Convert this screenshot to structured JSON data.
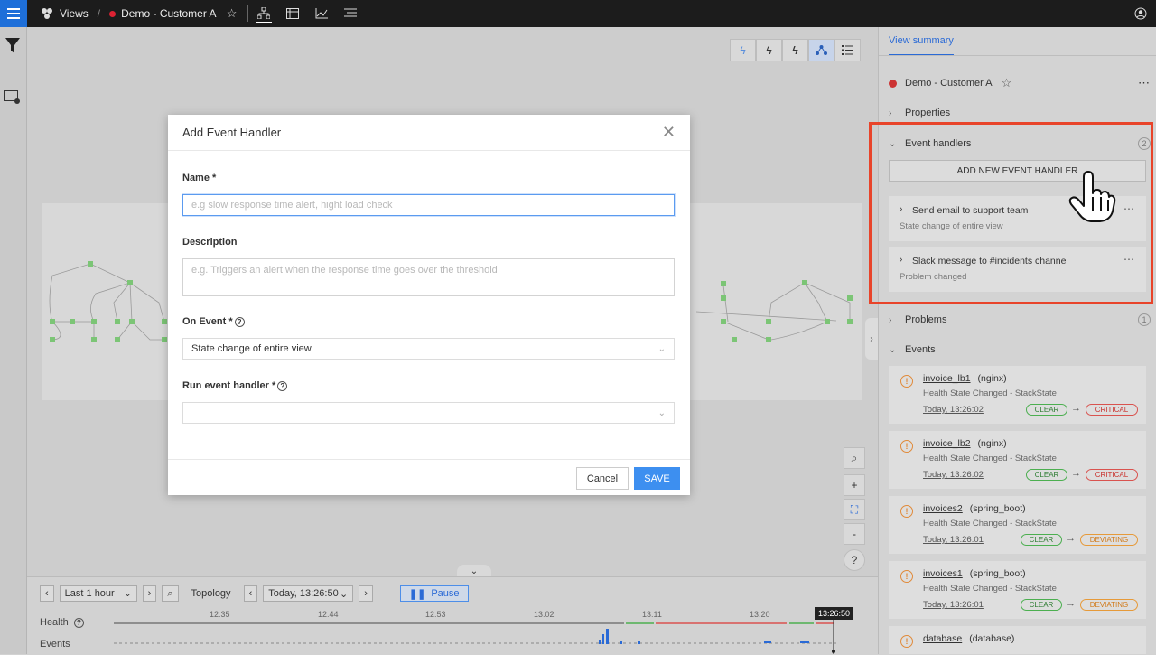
{
  "topbar": {
    "section": "Views",
    "separator": "/",
    "view_name": "Demo - Customer A",
    "star_icon": "star-outline-icon",
    "icons": [
      "topology-icon",
      "table-icon",
      "chart-icon",
      "events-list-icon"
    ],
    "user_icon": "user-icon"
  },
  "left_rail": {
    "icons": [
      "filter-icon",
      "view-settings-icon"
    ]
  },
  "toolbar": {
    "icons": [
      "lightning-outline-icon",
      "lightning-half-icon",
      "lightning-icon",
      "topology-icon",
      "list-icon"
    ]
  },
  "zoom": {
    "search": "⌕",
    "in": "+",
    "fit": "⛶",
    "out": "-",
    "help": "?"
  },
  "collapse": "⌄",
  "timeline": {
    "range_label": "Last 1 hour",
    "mode_label": "Topology",
    "time_label": "Today, 13:26:50",
    "pause_label": "Pause",
    "health_label": "Health",
    "events_label": "Events",
    "ticks": [
      "12:35",
      "12:44",
      "12:53",
      "13:02",
      "13:11",
      "13:20"
    ],
    "now": "13:26:50"
  },
  "modal": {
    "title": "Add Event Handler",
    "name_label": "Name *",
    "name_placeholder": "e.g slow response time alert, hight load check",
    "description_label": "Description",
    "description_placeholder": "e.g. Triggers an alert when the response time goes over the threshold",
    "on_event_label": "On Event *",
    "on_event_value": "State change of entire view",
    "run_label": "Run event handler *",
    "run_value": "",
    "cancel_label": "Cancel",
    "save_label": "SAVE"
  },
  "sidebar": {
    "tab": "View summary",
    "view_name": "Demo - Customer A",
    "more": "⋯",
    "sections": {
      "properties": "Properties",
      "event_handlers": "Event handlers",
      "event_handlers_count": "2",
      "problems": "Problems",
      "problems_count": "1",
      "events": "Events"
    },
    "add_handler_label": "ADD NEW EVENT HANDLER",
    "handlers": [
      {
        "title": "Send email to support team",
        "sub": "State change of entire view"
      },
      {
        "title": "Slack message to #incidents channel",
        "sub": "Problem changed"
      }
    ],
    "events": [
      {
        "name": "invoice_lb1",
        "type": "(nginx)",
        "desc": "Health State Changed  -  StackState",
        "time": "Today, 13:26:02",
        "from": "CLEAR",
        "to": "CRITICAL"
      },
      {
        "name": "invoice_lb2",
        "type": "(nginx)",
        "desc": "Health State Changed  -  StackState",
        "time": "Today, 13:26:02",
        "from": "CLEAR",
        "to": "CRITICAL"
      },
      {
        "name": "invoices2",
        "type": "(spring_boot)",
        "desc": "Health State Changed  -  StackState",
        "time": "Today, 13:26:01",
        "from": "CLEAR",
        "to": "DEVIATING"
      },
      {
        "name": "invoices1",
        "type": "(spring_boot)",
        "desc": "Health State Changed  -  StackState",
        "time": "Today, 13:26:01",
        "from": "CLEAR",
        "to": "DEVIATING"
      },
      {
        "name": "database",
        "type": "(database)"
      }
    ]
  },
  "colors": {
    "accent": "#3d8ff0",
    "highlight": "#e8442a",
    "critical": "#d9534f",
    "clear": "#4caf50",
    "deviating": "#e69a3a"
  }
}
